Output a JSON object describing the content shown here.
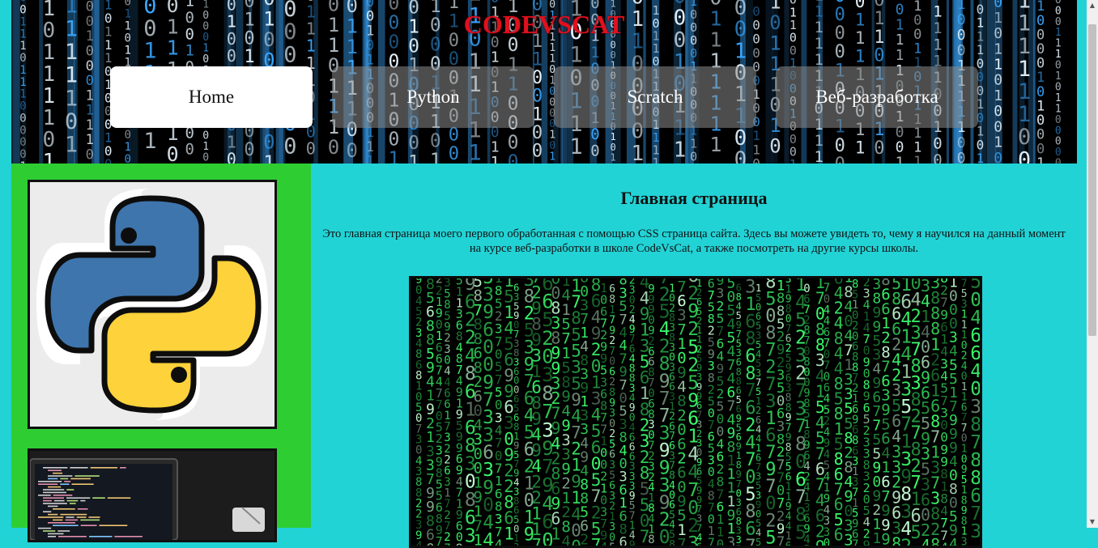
{
  "header": {
    "title": "CODEVSCAT",
    "nav": [
      {
        "label": "Home",
        "active": true
      },
      {
        "label": "Python",
        "active": false
      },
      {
        "label": "Scratch",
        "active": false
      },
      {
        "label": "Веб-разработка",
        "active": false
      }
    ]
  },
  "main": {
    "heading": "Главная страница",
    "text": "Это главная страница моего первого обработанная с помощью CSS страница сайта. Здесь вы можете увидеть то, чему я научился на данный момент на курсе веб-разработки в школе CodeVsCat, а также посмотреть на другие курсы школы."
  },
  "sidebar": {
    "cards": [
      {
        "icon": "python-logo-icon"
      },
      {
        "icon": "laptop-code-image"
      }
    ]
  },
  "colors": {
    "page_bg": "#22d3d6",
    "sidebar_bg": "#2ece33",
    "title": "#e0101e",
    "matrix_blue": "#3aa8ff",
    "matrix_green": "#3cff6e"
  }
}
